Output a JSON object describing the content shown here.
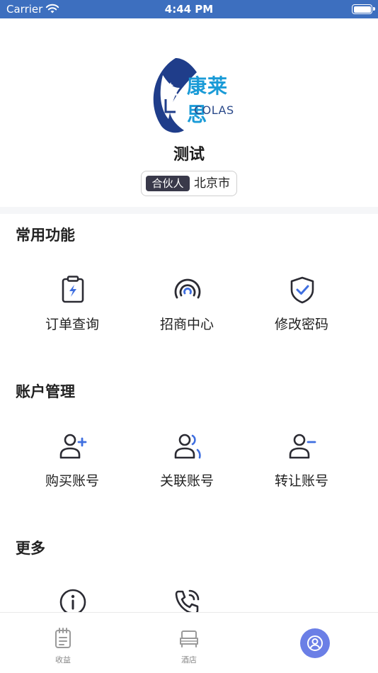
{
  "status_bar": {
    "carrier": "Carrier",
    "time": "4:44 PM"
  },
  "profile": {
    "logo_cn": "康莱思",
    "logo_en": "COLAS",
    "name": "测试",
    "role": "合伙人",
    "city": "北京市"
  },
  "sections": {
    "common": {
      "title": "常用功能",
      "items": [
        {
          "label": "订单查询",
          "icon": "clipboard-bolt-icon"
        },
        {
          "label": "招商中心",
          "icon": "signal-rings-icon"
        },
        {
          "label": "修改密码",
          "icon": "shield-check-icon"
        }
      ]
    },
    "account": {
      "title": "账户管理",
      "items": [
        {
          "label": "购买账号",
          "icon": "user-add-icon"
        },
        {
          "label": "关联账号",
          "icon": "user-link-icon"
        },
        {
          "label": "转让账号",
          "icon": "user-remove-icon"
        }
      ]
    },
    "more": {
      "title": "更多",
      "items": [
        {
          "icon": "info-icon"
        },
        {
          "icon": "phone-call-icon"
        }
      ]
    }
  },
  "tab_bar": {
    "tabs": [
      {
        "label": "收益",
        "icon": "notepad-icon"
      },
      {
        "label": "酒店",
        "icon": "bed-icon"
      },
      {
        "label": "",
        "icon": "profile-circle-icon",
        "active": true
      }
    ]
  },
  "colors": {
    "status_bar": "#3d6fbf",
    "accent_blue": "#3f6fe0",
    "active_tab": "#6b7fe6",
    "logo_navy": "#1f3d8a",
    "logo_cyan": "#1a9bd7"
  }
}
